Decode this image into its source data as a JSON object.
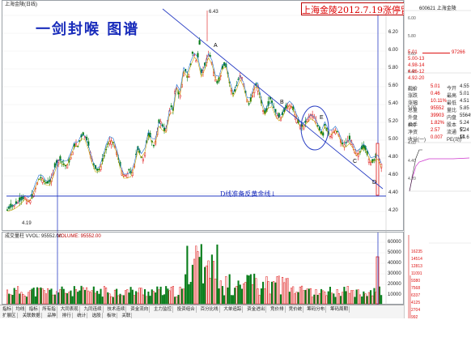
{
  "window": {
    "title": "上海金陵(日线)",
    "code_label": "600621 上海金陵"
  },
  "overlay": {
    "headline": "一剑封喉 图谱",
    "watermark": "上海金陵2012.7.19涨停留影"
  },
  "chart": {
    "peak_label": "6.43",
    "low_label": "4.19",
    "markers": [
      "A",
      "B",
      "C",
      "D",
      "E"
    ],
    "baseline_text": "D线准备反黄金线↓",
    "price_ticks": [
      "6.40",
      "6.20",
      "6.00",
      "5.80",
      "5.60",
      "5.40",
      "5.20",
      "5.00",
      "4.80",
      "4.60",
      "4.40",
      "4.20"
    ],
    "right_ticks": [
      "6.00",
      "5.80",
      "5.60",
      "5.40",
      "5.20",
      "5.00",
      "4.80",
      "4.60",
      "4.40",
      "4.20"
    ],
    "volume_label_left": "成交量柱 VVOL: 95552.00",
    "volume_label_right": "VOLUME: 95552.00",
    "volume_ticks": [
      "60000",
      "50000",
      "40000",
      "30000",
      "20000",
      "10000"
    ],
    "volume_right_ticks": [
      "16235",
      "14514",
      "12813",
      "11091",
      "9380",
      "7568",
      "6337",
      "4125",
      "2704",
      "992"
    ]
  },
  "right_panel": {
    "orderbook": [
      {
        "label": "5.01",
        "value": "97266"
      },
      {
        "label": "5.00-13",
        "value": ""
      },
      {
        "label": "4.98-14",
        "value": ""
      },
      {
        "label": "4.96-12",
        "value": ""
      },
      {
        "label": "4.92-20",
        "value": ""
      }
    ],
    "stats": [
      {
        "k": "现价",
        "v": "5.01",
        "k2": "今开",
        "v2": "4.55"
      },
      {
        "k": "涨跌",
        "v": "0.46",
        "k2": "最高",
        "v2": "5.01"
      },
      {
        "k": "涨幅",
        "v": "10.11%",
        "k2": "最低",
        "v2": "4.51"
      },
      {
        "k": "总量",
        "v": "95552",
        "k2": "量比",
        "v2": "5.85"
      },
      {
        "k": "外盘",
        "v": "39903",
        "k2": "内盘",
        "v2": "55649"
      },
      {
        "k": "换手",
        "v": "1.82%",
        "k2": "股本",
        "v2": "5.24亿"
      },
      {
        "k": "净资",
        "v": "2.57",
        "k2": "流通",
        "v2": "5.24亿"
      },
      {
        "k": "收益(一)",
        "v": "0.007",
        "k2": "PE(动)",
        "v2": "14.6"
      }
    ]
  },
  "tabs_row1": [
    "指标",
    "均线",
    "指标",
    "所有指",
    "大同表现",
    "九同连续",
    "技术连续",
    "资金流向",
    "主力监控",
    "投资组合",
    "百分比线",
    "大单追踪",
    "资金进出",
    "竞价排",
    "竞价统",
    "筹码分布",
    "筹码周期"
  ],
  "tabs_row2": [
    "扩展区",
    "关联数据",
    "品种",
    "排行",
    "统计",
    "选股",
    "板块",
    "关联"
  ]
}
